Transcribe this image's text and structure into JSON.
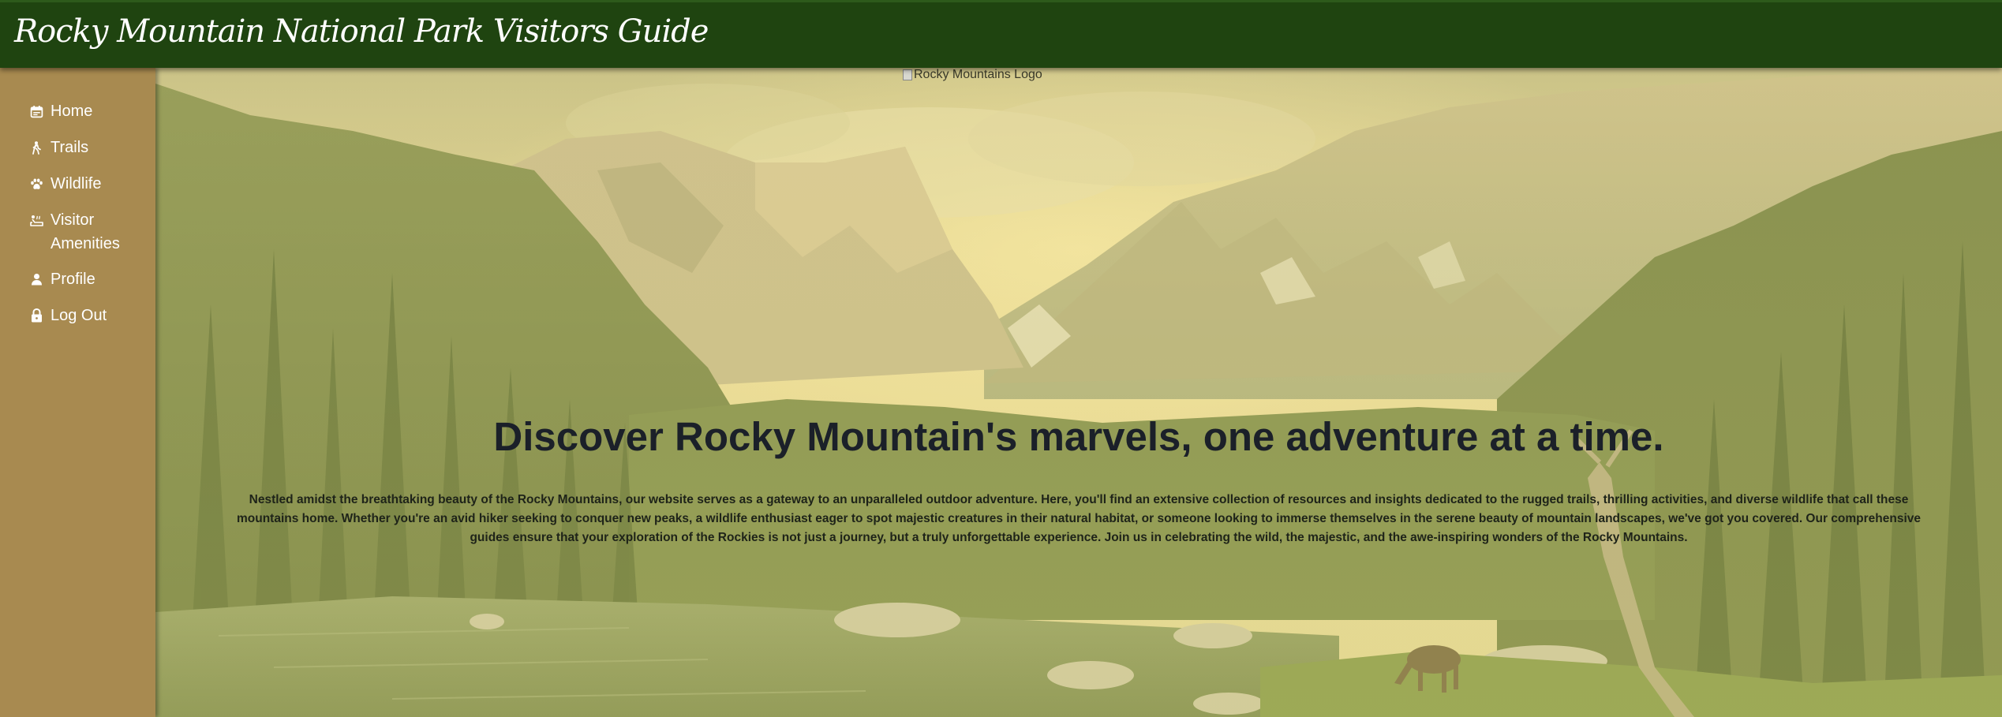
{
  "header": {
    "site_title": "Rocky Mountain National Park Visitors Guide"
  },
  "sidebar": {
    "items": [
      {
        "label": "Home",
        "icon": "calendar-icon"
      },
      {
        "label": "Trails",
        "icon": "hiker-icon"
      },
      {
        "label": "Wildlife",
        "icon": "paw-icon"
      },
      {
        "label": "Visitor Amenities",
        "icon": "hot-tub-icon"
      },
      {
        "label": "Profile",
        "icon": "user-icon"
      },
      {
        "label": "Log Out",
        "icon": "lock-icon"
      }
    ]
  },
  "main": {
    "logo_alt": "Rocky Mountains Logo",
    "tagline": "Discover Rocky Mountain's marvels, one adventure at a time.",
    "intro": "Nestled amidst the breathtaking beauty of the Rocky Mountains, our website serves as a gateway to an unparalleled outdoor adventure. Here, you'll find an extensive collection of resources and insights dedicated to the rugged trails, thrilling activities, and diverse wildlife that call these mountains home. Whether you're an avid hiker seeking to conquer new peaks, a wildlife enthusiast eager to spot majestic creatures in their natural habitat, or someone looking to immerse themselves in the serene beauty of mountain landscapes, we've got you covered. Our comprehensive guides ensure that your exploration of the Rockies is not just a journey, but a truly unforgettable experience. Join us in celebrating the wild, the majestic, and the awe-inspiring wonders of the Rocky Mountains."
  },
  "colors": {
    "header_bg": "#1f4410",
    "sidebar_bg": "#a88a50",
    "nav_text": "#ffffff",
    "heading_text": "#1b2029"
  }
}
